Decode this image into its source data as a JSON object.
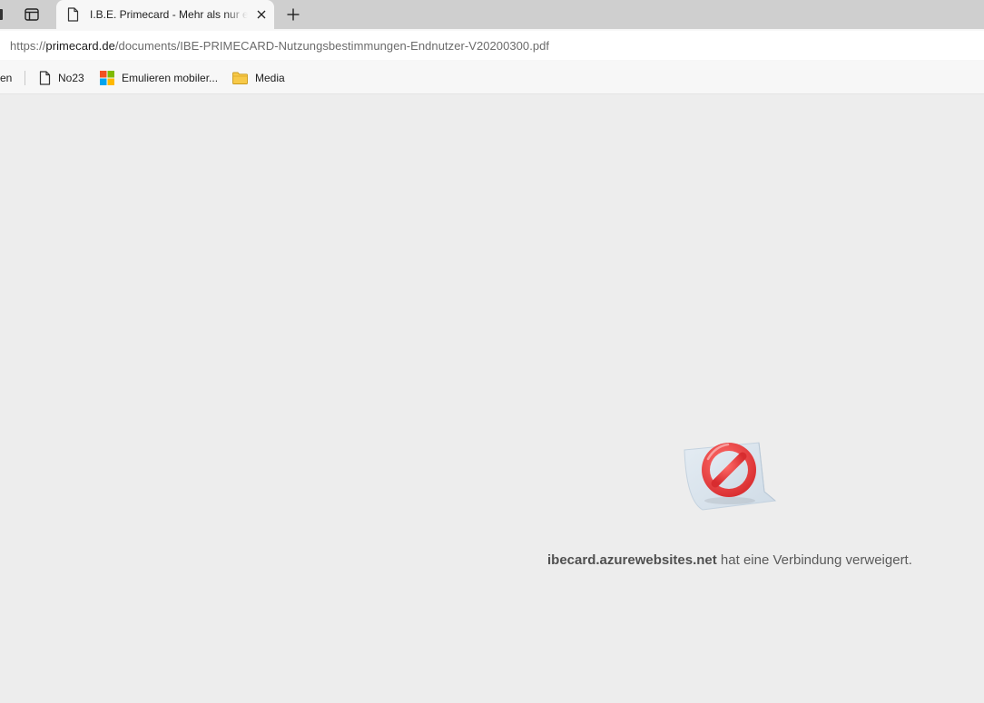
{
  "tabs": {
    "active_title": "I.B.E. Primecard - Mehr als nur eine Karte"
  },
  "address_bar": {
    "scheme": "https://",
    "host": "primecard.de",
    "path": "/documents/IBE-PRIMECARD-Nutzungsbestimmungen-Endnutzer-V20200300.pdf"
  },
  "bookmarks": {
    "truncated_item": "en",
    "items": [
      {
        "label": "No23",
        "icon": "page-icon"
      },
      {
        "label": "Emulieren mobiler...",
        "icon": "microsoft-logo-icon"
      },
      {
        "label": "Media",
        "icon": "folder-icon"
      }
    ]
  },
  "error": {
    "host": "ibecard.azurewebsites.net",
    "message": "hat eine Verbindung verweigert."
  },
  "colors": {
    "tabstrip": "#cfcfcf",
    "content_bg": "#ededed",
    "error_red": "#e5393b"
  }
}
